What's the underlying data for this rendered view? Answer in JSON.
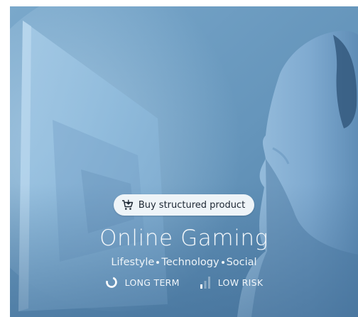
{
  "card": {
    "action_button": {
      "label": "Buy structured product",
      "icon": "cart-icon"
    },
    "title": "Online Gaming",
    "tags": [
      "Lifestyle",
      "Technology",
      "Social"
    ],
    "duration": {
      "label": "LONG TERM",
      "icon": "circle-arc-icon"
    },
    "risk": {
      "label": "LOW RISK",
      "icon": "signal-bars-icon",
      "level_bars_filled": 1,
      "level_bars_total": 3
    },
    "colors": {
      "overlay": "#6d9ec3",
      "pill_background": "#eef4f8",
      "text": "#ffffff"
    }
  }
}
